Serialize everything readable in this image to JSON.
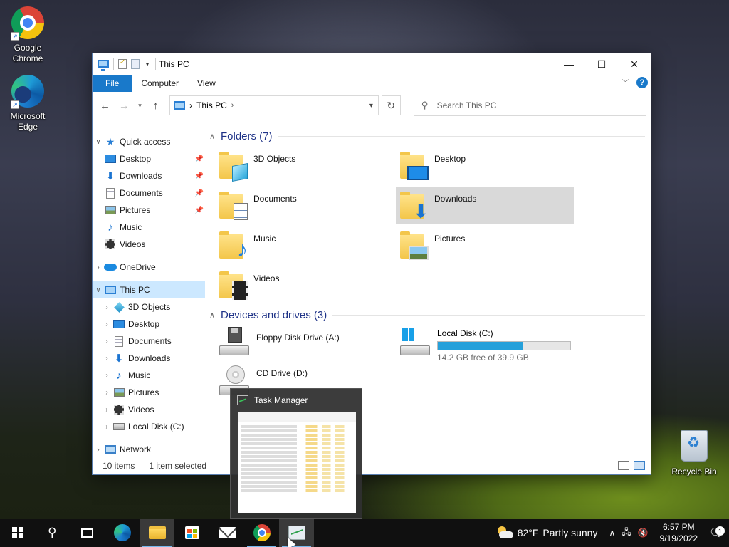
{
  "desktop": {
    "icons": [
      {
        "label": "Google Chrome",
        "icon": "chrome-icon"
      },
      {
        "label": "Microsoft Edge",
        "icon": "edge-icon"
      },
      {
        "label": "Recycle Bin",
        "icon": "recycle-bin-icon"
      }
    ]
  },
  "window": {
    "title": "This PC",
    "controls": {
      "minimize": "—",
      "maximize": "☐",
      "close": "✕"
    },
    "ribbon_tabs": [
      "File",
      "Computer",
      "View"
    ],
    "address": {
      "crumb": "This PC",
      "separator": "›"
    },
    "search_placeholder": "Search This PC",
    "nav": {
      "quick_access": "Quick access",
      "quick_items": [
        "Desktop",
        "Downloads",
        "Documents",
        "Pictures",
        "Music",
        "Videos"
      ],
      "onedrive": "OneDrive",
      "this_pc": "This PC",
      "pc_items": [
        "3D Objects",
        "Desktop",
        "Documents",
        "Downloads",
        "Music",
        "Pictures",
        "Videos",
        "Local Disk (C:)"
      ],
      "network": "Network"
    },
    "folders_header": "Folders (7)",
    "folders": [
      "3D Objects",
      "Desktop",
      "Documents",
      "Downloads",
      "Music",
      "Pictures",
      "Videos"
    ],
    "selected_folder": "Downloads",
    "drives_header": "Devices and drives (3)",
    "drives": {
      "floppy": "Floppy Disk Drive (A:)",
      "local": "Local Disk (C:)",
      "local_free": "14.2 GB free of 39.9 GB",
      "local_used_fraction": 0.644,
      "cd": "CD Drive (D:)"
    },
    "status": {
      "items": "10 items",
      "selected": "1 item selected"
    }
  },
  "thumbnail": {
    "title": "Task Manager"
  },
  "taskbar": {
    "weather": {
      "temp": "82°F",
      "condition": "Partly sunny"
    },
    "clock": {
      "time": "6:57 PM",
      "date": "9/19/2022"
    },
    "notifications": "1",
    "accent": "#76b9ed"
  }
}
